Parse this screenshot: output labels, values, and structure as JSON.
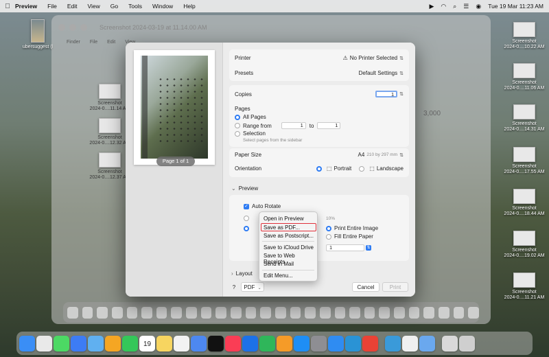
{
  "menubar": {
    "app": "Preview",
    "items": [
      "File",
      "Edit",
      "View",
      "Go",
      "Tools",
      "Window",
      "Help"
    ],
    "datetime": "Tue 19 Mar  11:23 AM"
  },
  "background_window": {
    "title": "Screenshot 2024-03-19 at 11.14.00 AM",
    "finder_items": [
      "Finder",
      "File",
      "Edit",
      "View"
    ],
    "values": [
      "3,000"
    ]
  },
  "desktop_left": [
    {
      "label": "ubersuggest (l"
    },
    {
      "label": "Screenshot\n2024-0....11.14 AM"
    },
    {
      "label": "Screenshot\n2024-0....12.32 AM"
    },
    {
      "label": "Screenshot\n2024-0....12.37 AM"
    }
  ],
  "desktop_right": [
    {
      "label": "Screenshot\n2024-0....10.22 AM"
    },
    {
      "label": "Screenshot\n2024-0....11.06 AM"
    },
    {
      "label": "Screenshot\n2024-0....14.31 AM"
    },
    {
      "label": "Screenshot\n2024-0....17.55 AM"
    },
    {
      "label": "Screenshot\n2024-0....18.44 AM"
    },
    {
      "label": "Screenshot\n2024-0....19.02 AM"
    },
    {
      "label": "Screenshot\n2024-0....11.21 AM"
    }
  ],
  "print": {
    "page_label": "Page 1 of 1",
    "printer_label": "Printer",
    "printer_value": "No Printer Selected",
    "presets_label": "Presets",
    "presets_value": "Default Settings",
    "copies_label": "Copies",
    "copies_value": "1",
    "pages_label": "Pages",
    "all_pages": "All Pages",
    "range_from": "Range from",
    "range_start": "1",
    "range_to": "to",
    "range_end": "1",
    "selection": "Selection",
    "selection_hint": "Select pages from the sidebar",
    "paper_size_label": "Paper Size",
    "paper_size_value": "A4",
    "paper_size_dims": "210 by 297 mm",
    "orientation_label": "Orientation",
    "portrait": "Portrait",
    "landscape": "Landscape",
    "preview_header": "Preview",
    "auto_rotate": "Auto Rotate",
    "scale_hint": "10%",
    "print_entire_image": "Print Entire Image",
    "fill_entire_paper": "Fill Entire Paper",
    "copies_per_page_value": "1",
    "layout_header": "Layout",
    "help": "?",
    "pdf": "PDF",
    "cancel": "Cancel",
    "print_btn": "Print"
  },
  "pdf_menu": {
    "items": [
      "Open in Preview",
      "Save as PDF...",
      "Save as Postscript...",
      "Save to iCloud Drive",
      "Save to Web Receipts",
      "Send in Mail",
      "Edit Menu..."
    ],
    "highlighted": "Save as PDF..."
  },
  "dock": {
    "icons": [
      "finder-icon",
      "launchpad-icon",
      "messages-icon",
      "mail-icon",
      "maps-icon",
      "photos-icon",
      "facetime-icon",
      "calendar-icon",
      "notes-icon",
      "reminders-icon",
      "freeform-icon",
      "tv-icon",
      "music-icon",
      "keynote-icon",
      "numbers-icon",
      "pages-icon",
      "appstore-icon",
      "settings-icon",
      "safari-icon",
      "edge-icon",
      "chrome-icon",
      "chat-icon",
      "mail2-icon",
      "preview-icon",
      "desktop-icon",
      "trash-icon"
    ],
    "calendar_day": "19"
  }
}
